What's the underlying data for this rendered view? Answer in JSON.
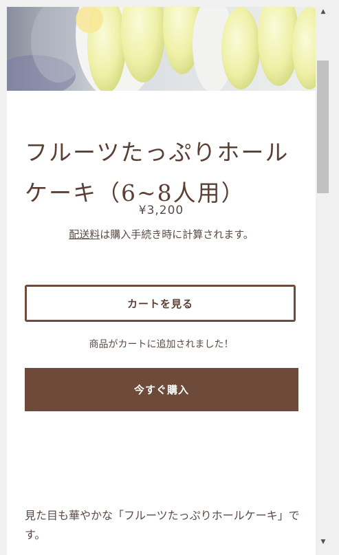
{
  "product": {
    "title": "フルーツたっぷりホールケーキ（6~8人用）",
    "price": "¥3,200",
    "shipping_link": "配送料",
    "shipping_text": "は購入手続き時に計算されます。",
    "view_cart_label": "カートを見る",
    "added_message": "商品がカートに追加されました！",
    "buy_now_label": "今すぐ購入",
    "description": "見た目も華やかな「フルーツたっぷりホールケーキ」です。"
  },
  "scrollbar": {
    "up_icon": "▲",
    "down_icon": "▼",
    "position": 0.1
  },
  "colors": {
    "accent": "#6e4a3a",
    "text": "#5a4a44",
    "title": "#5a3f35"
  }
}
